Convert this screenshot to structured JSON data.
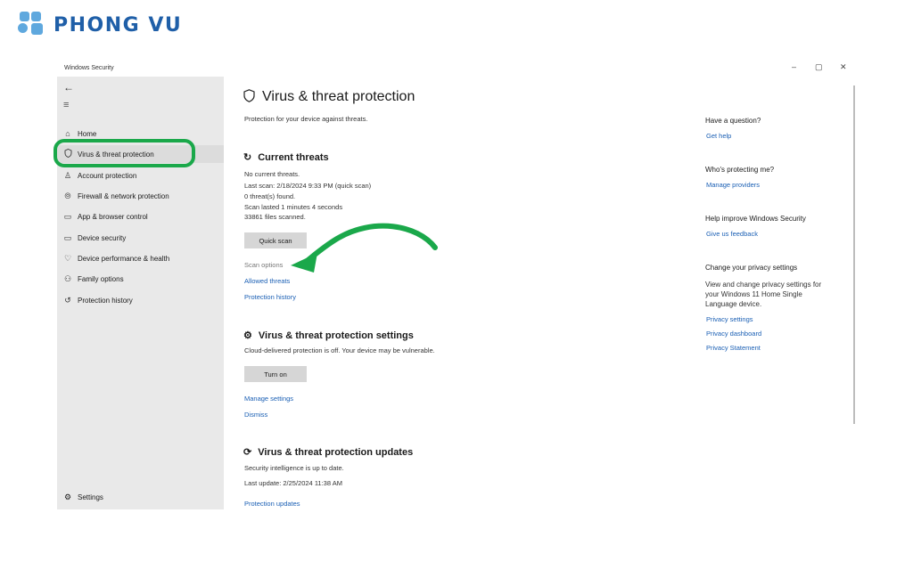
{
  "logo": {
    "text": "PHONG VU",
    "color": "#1f5fa8",
    "mark_color": "#5fa8de"
  },
  "window": {
    "title": "Windows Security",
    "controls": {
      "minimize": "–",
      "restore": "▢",
      "close": "✕"
    }
  },
  "sidebar": {
    "back_icon": "←",
    "menu_icon": "≡",
    "items": [
      {
        "label": "Home",
        "icon": "home-icon"
      },
      {
        "label": "Virus & threat protection",
        "icon": "shield-icon",
        "active": true
      },
      {
        "label": "Account protection",
        "icon": "person-icon"
      },
      {
        "label": "Firewall & network protection",
        "icon": "wifi-icon"
      },
      {
        "label": "App & browser control",
        "icon": "window-icon"
      },
      {
        "label": "Device security",
        "icon": "laptop-icon"
      },
      {
        "label": "Device performance & health",
        "icon": "heart-icon"
      },
      {
        "label": "Family options",
        "icon": "family-icon"
      },
      {
        "label": "Protection history",
        "icon": "history-icon"
      }
    ],
    "settings_label": "Settings"
  },
  "main": {
    "title": "Virus & threat protection",
    "subtitle": "Protection for your device against threats.",
    "current_threats": {
      "heading": "Current threats",
      "lines": [
        "No current threats.",
        "Last scan: 2/18/2024 9:33 PM (quick scan)",
        "0 threat(s) found.",
        "Scan lasted 1 minutes 4 seconds",
        "33861 files scanned."
      ],
      "quick_scan_label": "Quick scan",
      "scan_options_label": "Scan options",
      "allowed_threats_label": "Allowed threats",
      "protection_history_label": "Protection history"
    },
    "settings_section": {
      "heading": "Virus & threat protection settings",
      "status": "Cloud-delivered protection is off. Your device may be vulnerable.",
      "turn_on_label": "Turn on",
      "manage_settings_label": "Manage settings",
      "dismiss_label": "Dismiss"
    },
    "updates_section": {
      "heading": "Virus & threat protection updates",
      "status": "Security intelligence is up to date.",
      "last_update": "Last update: 2/25/2024 11:38 AM",
      "protection_updates_label": "Protection updates"
    }
  },
  "right_pane": {
    "question": {
      "heading": "Have a question?",
      "link": "Get help"
    },
    "protecting": {
      "heading": "Who's protecting me?",
      "link": "Manage providers"
    },
    "improve": {
      "heading": "Help improve Windows Security",
      "link": "Give us feedback"
    },
    "privacy": {
      "heading": "Change your privacy settings",
      "text": "View and change privacy settings for your Windows 11 Home Single Language device.",
      "links": [
        "Privacy settings",
        "Privacy dashboard",
        "Privacy Statement"
      ]
    }
  },
  "annotations": {
    "highlight_color": "#1aa84a",
    "arrow_color": "#1aa84a"
  },
  "colors": {
    "link": "#1a5fb4",
    "sidebar_bg": "#e9e9e9",
    "button_bg": "#d6d6d6"
  }
}
